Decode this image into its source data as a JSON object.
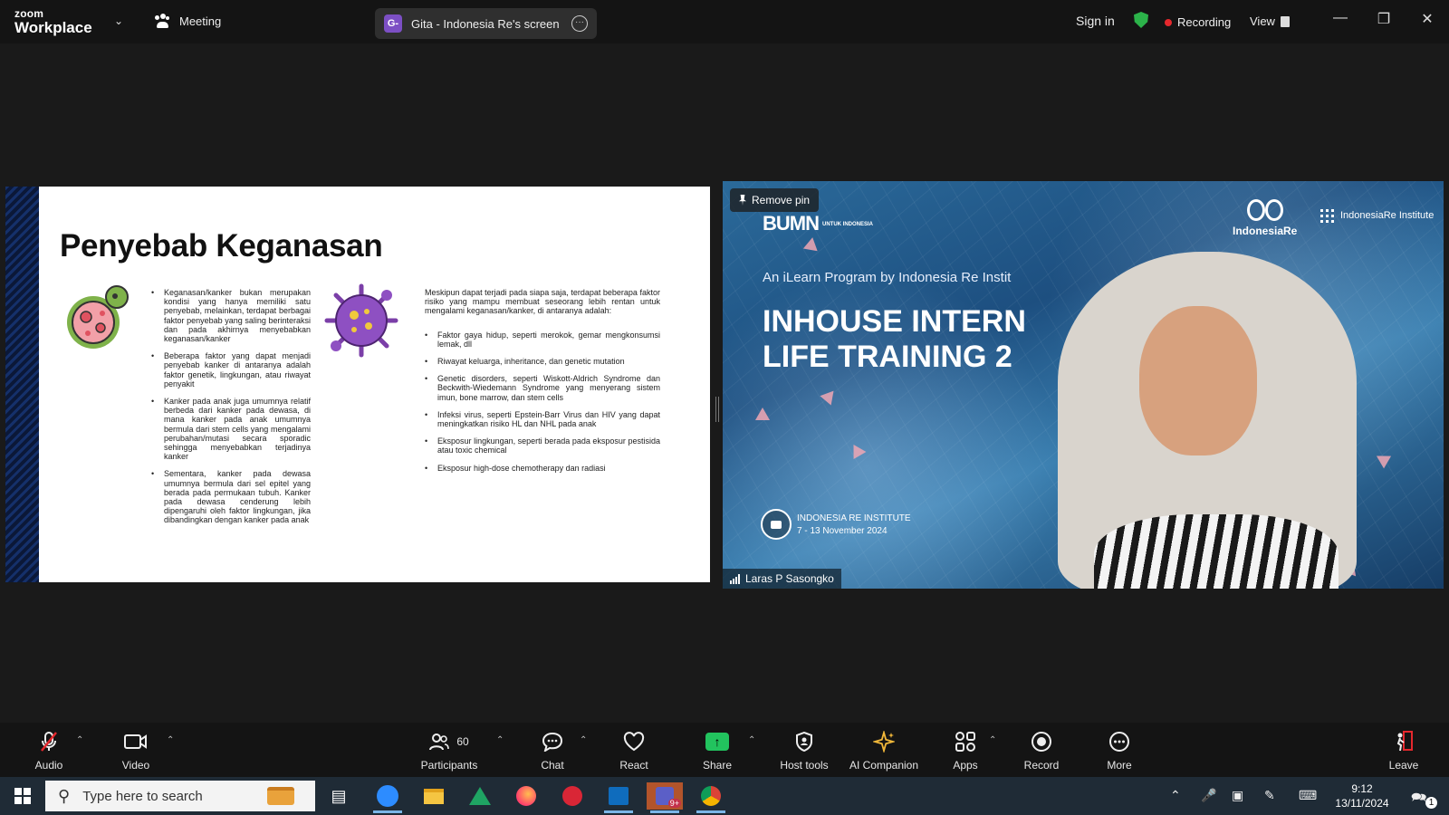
{
  "window": {
    "brand_small": "zoom",
    "brand_large": "Workplace",
    "meeting_label": "Meeting",
    "share_title": "Gita - Indonesia Re's screen",
    "share_avatar": "G-",
    "sign_in": "Sign in",
    "recording": "Recording",
    "view": "View",
    "controls": [
      "minimize-icon",
      "restore-icon",
      "close-icon"
    ]
  },
  "slide": {
    "title": "Penyebab Keganasan",
    "left_bullets": [
      "Keganasan/kanker bukan merupakan kondisi yang hanya memiliki satu penyebab, melainkan, terdapat berbagai faktor penyebab yang saling berinteraksi dan pada akhirnya menyebabkan keganasan/kanker",
      "Beberapa faktor yang dapat menjadi penyebab kanker di antaranya adalah faktor genetik, lingkungan, atau riwayat penyakit",
      "Kanker pada anak juga umumnya relatif berbeda dari kanker pada dewasa, di mana kanker pada anak umumnya bermula dari stem cells yang mengalami perubahan/mutasi secara sporadic sehingga menyebabkan terjadinya kanker",
      "Sementara, kanker pada dewasa umumnya bermula dari sel epitel yang berada pada permukaan tubuh. Kanker pada dewasa cenderung lebih dipengaruhi oleh faktor lingkungan, jika dibandingkan dengan kanker pada anak"
    ],
    "right_intro": "Meskipun dapat terjadi pada siapa saja, terdapat beberapa faktor risiko yang mampu membuat seseorang lebih rentan untuk mengalami keganasan/kanker, di antaranya adalah:",
    "right_bullets": [
      "Faktor gaya hidup, seperti merokok, gemar mengkonsumsi lemak, dll",
      "Riwayat keluarga, inheritance, dan genetic mutation",
      "Genetic disorders, seperti Wiskott-Aldrich Syndrome dan Beckwith-Wiedemann Syndrome yang menyerang sistem imun, bone marrow, dan stem cells",
      "Infeksi virus, seperti Epstein-Barr Virus dan HIV yang dapat meningkatkan risiko HL dan NHL pada anak",
      "Eksposur lingkungan, seperti berada pada eksposur pestisida atau toxic chemical",
      "Eksposur high-dose chemotherapy dan radiasi"
    ]
  },
  "video": {
    "remove_pin": "Remove pin",
    "bumn": "BUMN",
    "bumn_sub": "UNTUK INDONESIA",
    "ir_logo": "IndonesiaRe",
    "iri_logo": "IndonesiaRe Institute",
    "program": "An iLearn Program by Indonesia Re Instit",
    "headline_1": "INHOUSE INTERN",
    "headline_2": "LIFE TRAINING 2",
    "event_org": "INDONESIA RE INSTITUTE",
    "event_date": "7 - 13 November 2024",
    "participant_name": "Laras P Sasongko"
  },
  "toolbar": {
    "audio": "Audio",
    "video": "Video",
    "participants": "Participants",
    "participants_count": "60",
    "chat": "Chat",
    "react": "React",
    "share": "Share",
    "host_tools": "Host tools",
    "ai_companion": "AI Companion",
    "apps": "Apps",
    "record": "Record",
    "more": "More",
    "leave": "Leave"
  },
  "taskbar": {
    "search_placeholder": "Type here to search",
    "time": "9:12",
    "date": "13/11/2024",
    "notification_count": "1",
    "teams_badge": "9+"
  },
  "colors": {
    "zoom_bg": "#141414",
    "recording_dot": "#e5282d",
    "share_green": "#22c35e",
    "shield_green": "#2cb34a",
    "taskbar": "#1f2b36"
  }
}
